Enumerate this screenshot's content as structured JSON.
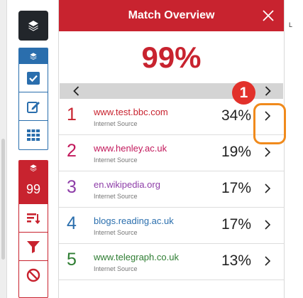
{
  "toolbar": {
    "match_score": "99"
  },
  "panel": {
    "title": "Match Overview",
    "overall_percent": "99%"
  },
  "callout": {
    "badge": "1"
  },
  "corner_mark": "L",
  "matches": [
    {
      "rank": "1",
      "source": "www.test.bbc.com",
      "type": "Internet Source",
      "percent": "34%",
      "color": "#c8232f"
    },
    {
      "rank": "2",
      "source": "www.henley.ac.uk",
      "type": "Internet Source",
      "percent": "19%",
      "color": "#c2185b"
    },
    {
      "rank": "3",
      "source": "en.wikipedia.org",
      "type": "Internet Source",
      "percent": "17%",
      "color": "#8e3ea8"
    },
    {
      "rank": "4",
      "source": "blogs.reading.ac.uk",
      "type": "Internet Source",
      "percent": "17%",
      "color": "#2a6ead"
    },
    {
      "rank": "5",
      "source": "www.telegraph.co.uk",
      "type": "Internet Source",
      "percent": "13%",
      "color": "#2e7d32"
    }
  ],
  "colors": {
    "accent_red": "#c8232f",
    "accent_blue": "#2a6ead",
    "highlight_orange": "#f08a1c",
    "toolbar_dark": "#22262b"
  }
}
